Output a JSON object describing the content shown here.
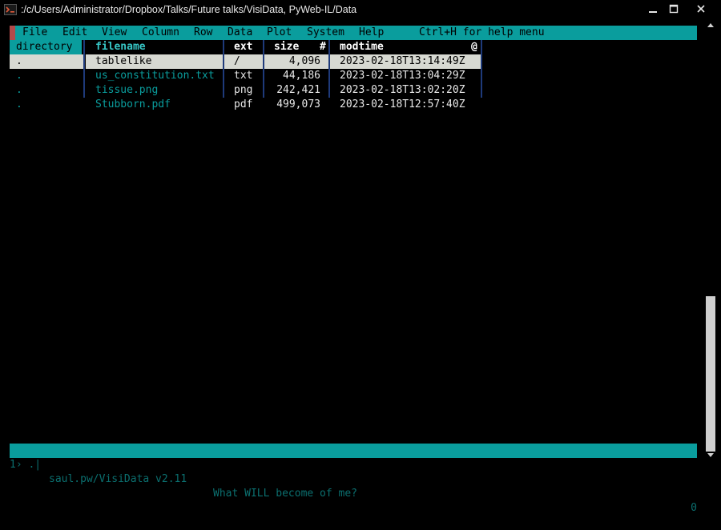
{
  "window": {
    "title": ":/c/Users/Administrator/Dropbox/Talks/Future talks/VisiData, PyWeb-IL/Data"
  },
  "menu": {
    "items": [
      "File",
      "Edit",
      "View",
      "Column",
      "Row",
      "Data",
      "Plot",
      "System",
      "Help"
    ],
    "hint": "Ctrl+H for help menu"
  },
  "columns": {
    "directory": "directory",
    "filename": "filename",
    "ext": "ext",
    "size": "size",
    "size_type": "#",
    "modtime": "modtime",
    "modtime_type": "@"
  },
  "rows": [
    {
      "directory": ".",
      "filename": "tablelike",
      "ext": "/",
      "size": "4,096",
      "modtime": "2023-02-18T13:14:49Z"
    },
    {
      "directory": ".",
      "filename": "us_constitution.txt",
      "ext": "txt",
      "size": "44,186",
      "modtime": "2023-02-18T13:04:29Z"
    },
    {
      "directory": ".",
      "filename": "tissue.png",
      "ext": "png",
      "size": "242,421",
      "modtime": "2023-02-18T13:02:20Z"
    },
    {
      "directory": ".",
      "filename": "Stubborn.pdf",
      "ext": "pdf",
      "size": "499,073",
      "modtime": "2023-02-18T12:57:40Z"
    }
  ],
  "status": {
    "sheet": "1› .|",
    "version": "saul.pw/VisiData v2.11",
    "message": "What WILL become of me?",
    "right": "0"
  },
  "colors": {
    "accent": "#0a9d9d",
    "selection": "#d7d9d2",
    "separator": "#1e3a7a"
  },
  "icons": {
    "app": "terminal-icon",
    "minimize": "minimize-icon",
    "maximize": "maximize-icon",
    "close": "close-icon"
  }
}
